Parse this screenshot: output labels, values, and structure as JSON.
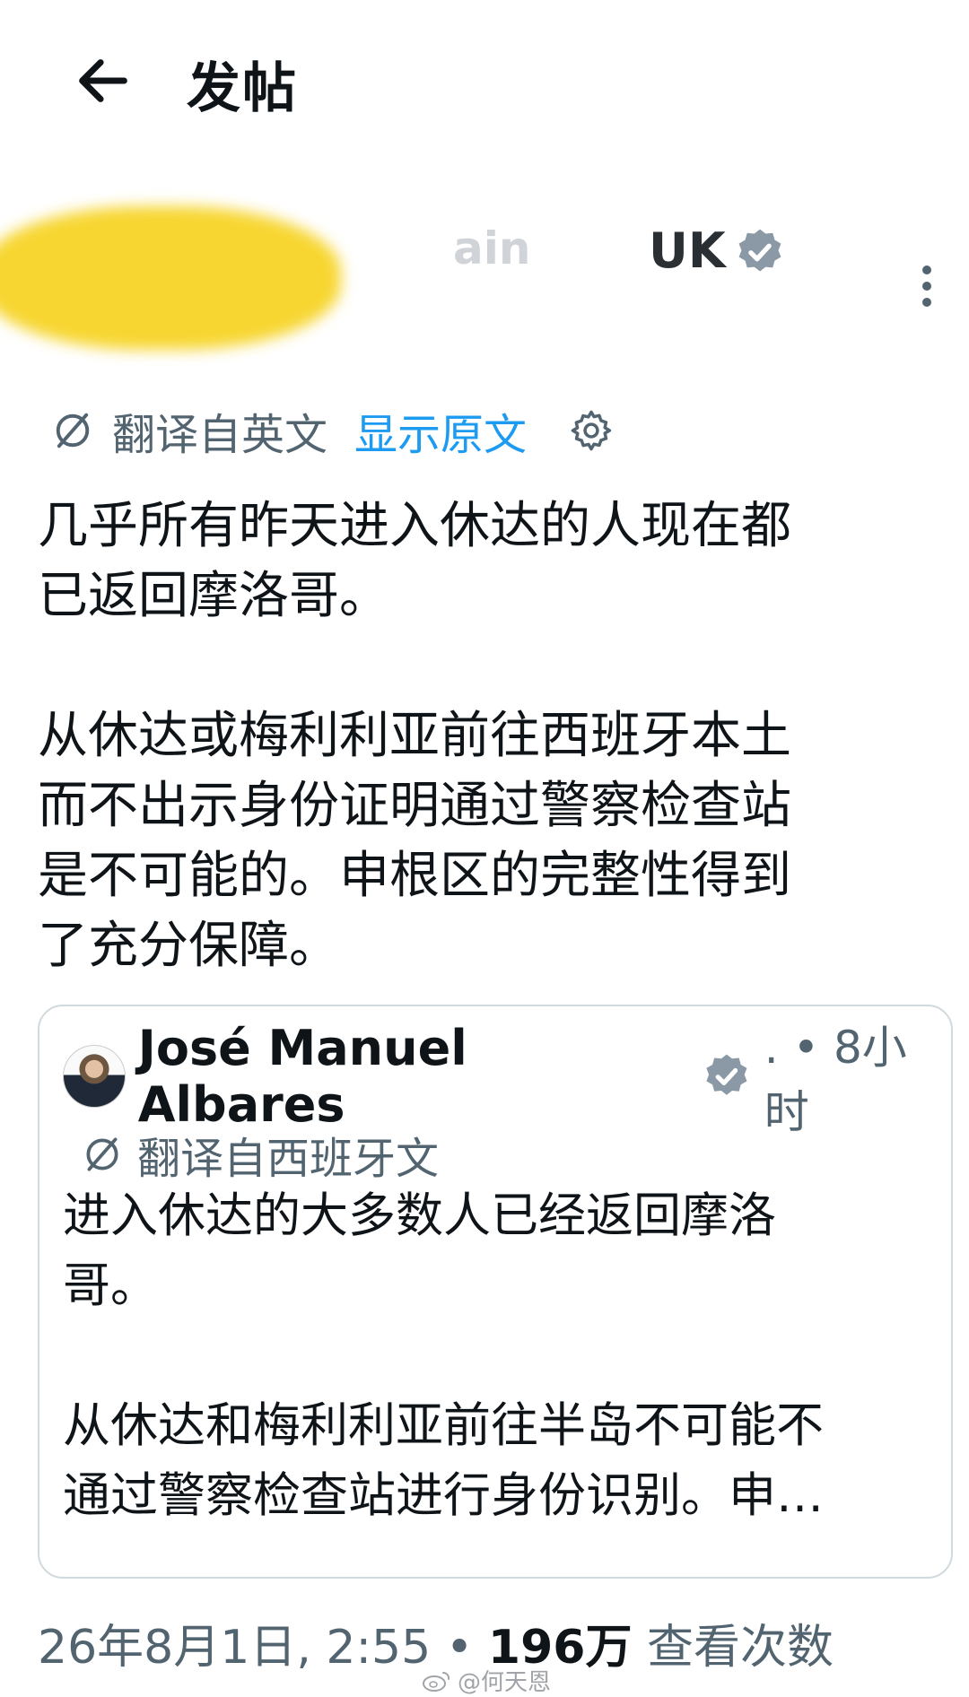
{
  "header": {
    "back_icon": "arrow-left-icon",
    "title": "发帖"
  },
  "author": {
    "name_faded": "ain",
    "name": "UK",
    "verified_icon": "verified-badge-icon",
    "more_icon": "more-vertical-icon",
    "redaction_color": "#f7d631"
  },
  "translation": {
    "icon": "translate-icon",
    "label": "翻译自英文",
    "show_original": "显示原文",
    "settings_icon": "gear-icon"
  },
  "post": {
    "paragraphs": [
      "几乎所有昨天进入休达的人现在都\n已返回摩洛哥。",
      "从休达或梅利利亚前往西班牙本土\n而不出示身份证明通过警察检查站\n是不可能的。申根区的完整性得到\n了充分保障。"
    ]
  },
  "quote": {
    "author": "José Manuel Albares",
    "verified_icon": "verified-badge-icon",
    "time": ". • 8小时",
    "translate_label": "翻译自西班牙文",
    "paragraphs": [
      "进入休达的大多数人已经返回摩洛\n哥。",
      "从休达和梅利利亚前往半岛不可能不\n通过警察检查站进行身份识别。申…"
    ]
  },
  "meta": {
    "timestamp": "26年8月1日, 2:55",
    "separator": " • ",
    "views_count": "196万",
    "views_label": " 查看次数"
  },
  "watermark": {
    "icon": "weibo-icon",
    "text": "@何天恩"
  },
  "colors": {
    "accent": "#1d9bf0",
    "secondary_text": "#536471",
    "primary_text": "#0f1419",
    "border": "#cfd9de"
  }
}
